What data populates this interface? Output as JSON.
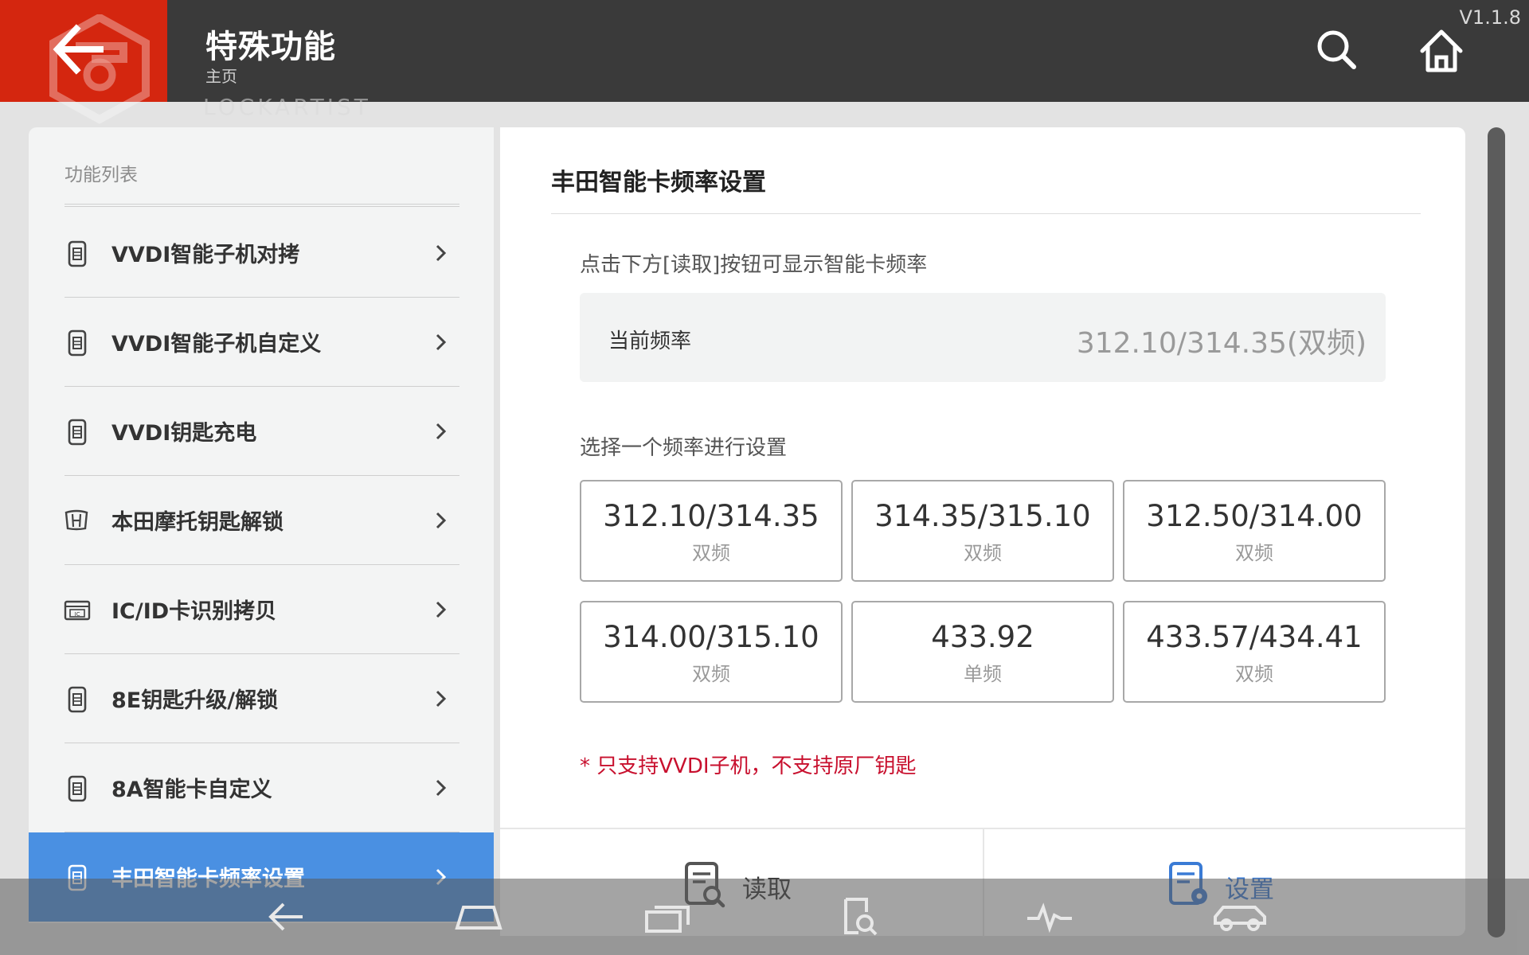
{
  "header": {
    "title": "特殊功能",
    "subtitle": "主页",
    "version": "V1.1.8",
    "watermark_text": "LOCKARTIST",
    "icons": {
      "back": "arrow-left-icon",
      "search": "search-icon",
      "home": "home-icon"
    }
  },
  "sidebar": {
    "heading": "功能列表",
    "items": [
      {
        "label": "VVDI智能子机对拷",
        "icon": "smart-key-icon",
        "active": false
      },
      {
        "label": "VVDI智能子机自定义",
        "icon": "smart-key-icon",
        "active": false
      },
      {
        "label": "VVDI钥匙充电",
        "icon": "smart-key-icon",
        "active": false
      },
      {
        "label": "本田摩托钥匙解锁",
        "icon": "honda-logo-icon",
        "active": false
      },
      {
        "label": "IC/ID卡识别拷贝",
        "icon": "ic-card-icon",
        "active": false
      },
      {
        "label": "8E钥匙升级/解锁",
        "icon": "smart-key-icon",
        "active": false
      },
      {
        "label": "8A智能卡自定义",
        "icon": "smart-key-icon",
        "active": false
      },
      {
        "label": "丰田智能卡频率设置",
        "icon": "smart-key-icon",
        "active": true
      }
    ]
  },
  "main": {
    "title": "丰田智能卡频率设置",
    "hint": "点击下方[读取]按钮可显示智能卡频率",
    "current_label": "当前频率",
    "current_value": "312.10/314.35(双频)",
    "select_hint": "选择一个频率进行设置",
    "options": [
      {
        "value": "312.10/314.35",
        "type": "双频"
      },
      {
        "value": "314.35/315.10",
        "type": "双频"
      },
      {
        "value": "312.50/314.00",
        "type": "双频"
      },
      {
        "value": "314.00/315.10",
        "type": "双频"
      },
      {
        "value": "433.92",
        "type": "单频"
      },
      {
        "value": "433.57/434.41",
        "type": "双频"
      }
    ],
    "note": "* 只支持VVDI子机，不支持原厂钥匙",
    "actions": {
      "read_label": "读取",
      "set_label": "设置"
    }
  },
  "colors": {
    "header_bg": "#3a3a3a",
    "back_bg": "#d4260f",
    "active_item": "#4a90e2",
    "note": "#c8102e",
    "set_action": "#3a7bd5"
  },
  "navbar": {
    "icons": [
      "nav-back-icon",
      "nav-home-icon",
      "nav-recents-icon",
      "nav-search-doc-icon",
      "nav-pulse-icon",
      "nav-car-icon"
    ]
  }
}
